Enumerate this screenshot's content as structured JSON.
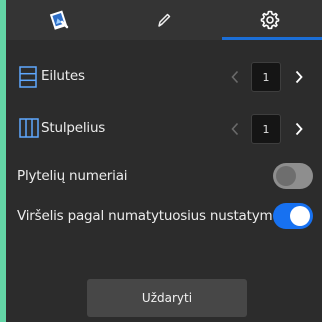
{
  "tabs": [
    {
      "icon": "book-cover-icon"
    },
    {
      "icon": "pencil-icon"
    },
    {
      "icon": "gear-icon",
      "active": true
    }
  ],
  "rows": {
    "label": "Eilutes",
    "value": "1",
    "icon": "rows-icon"
  },
  "columns": {
    "label": "Stulpelius",
    "value": "1",
    "icon": "columns-icon"
  },
  "tile_numbers": {
    "label": "Plytelių numeriai",
    "state": "off"
  },
  "default_cover": {
    "label": "Viršelis pagal numatytuosius nustatymus",
    "state": "on"
  },
  "close_label": "Uždaryti",
  "colors": {
    "accent": "#1771f1",
    "panel": "#2c2c2c",
    "background": "#63d5a6"
  }
}
